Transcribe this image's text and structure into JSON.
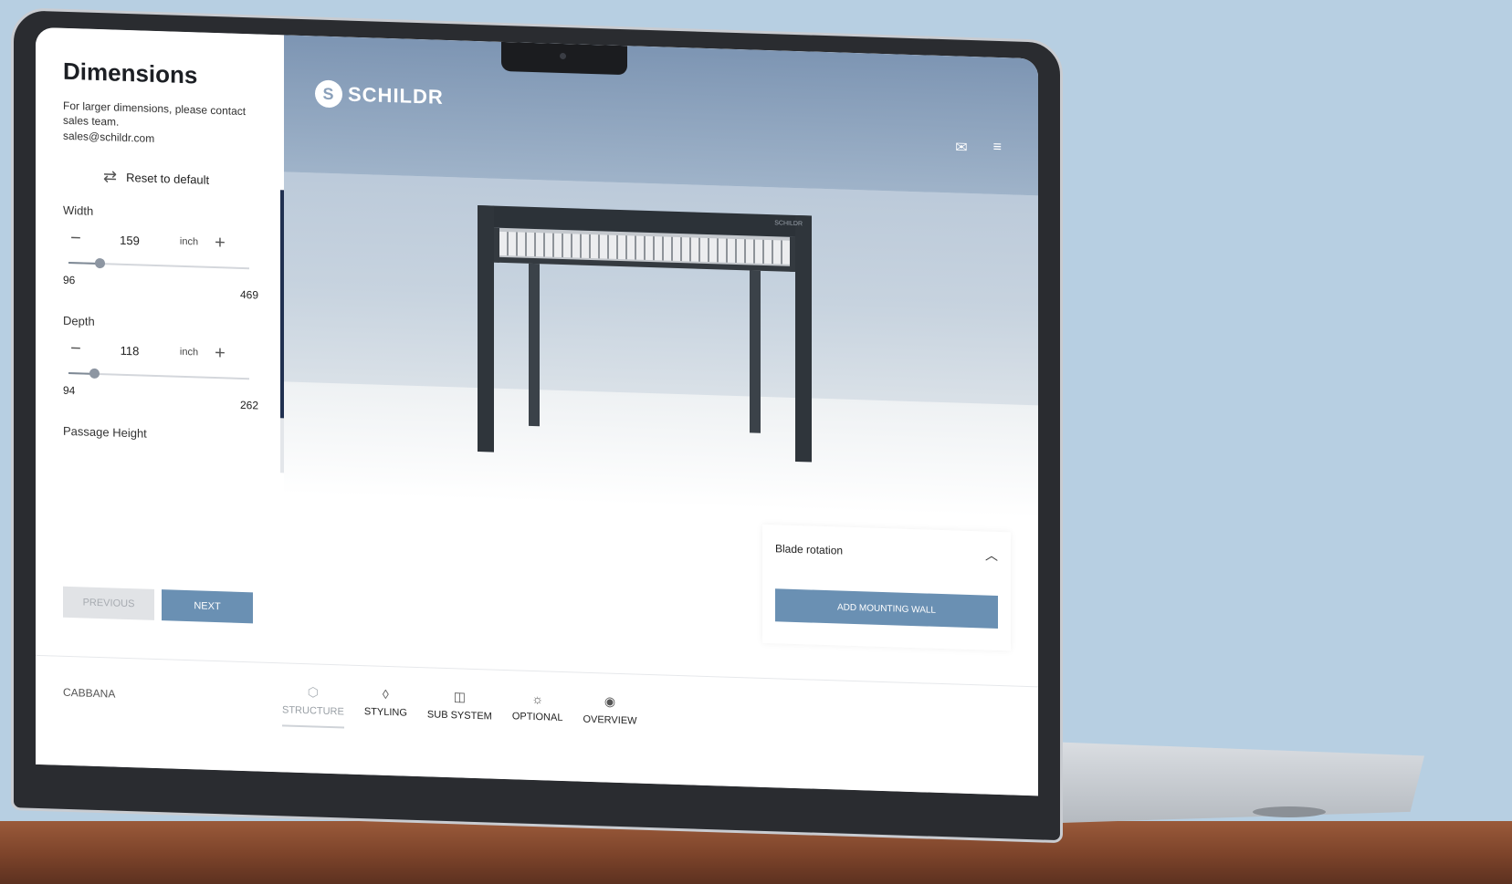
{
  "app": {
    "brand": "SCHILDR"
  },
  "sidebar": {
    "title": "Dimensions",
    "note": "For larger dimensions, please contact sales team.",
    "email": "sales@schildr.com",
    "reset_label": "Reset to default",
    "width": {
      "label": "Width",
      "value": "159",
      "unit": "inch",
      "min": "96",
      "max": "469",
      "fraction": 0.17
    },
    "depth": {
      "label": "Depth",
      "value": "118",
      "unit": "inch",
      "min": "94",
      "max": "262",
      "fraction": 0.14
    },
    "passage_height": {
      "label": "Passage Height"
    },
    "prev_label": "PREVIOUS",
    "next_label": "NEXT"
  },
  "viewport": {
    "pergola_brand": "SCHILDR"
  },
  "blade_panel": {
    "title": "Blade rotation",
    "button_label": "ADD MOUNTING WALL"
  },
  "bottombar": {
    "model": "CABBANA",
    "tabs": [
      {
        "label": "STRUCTURE",
        "icon": "cube-icon"
      },
      {
        "label": "STYLING",
        "icon": "drop-icon"
      },
      {
        "label": "SUB SYSTEM",
        "icon": "panel-icon"
      },
      {
        "label": "OPTIONAL",
        "icon": "sun-icon"
      },
      {
        "label": "OVERVIEW",
        "icon": "eye-icon"
      }
    ]
  },
  "colors": {
    "accent": "#6a90b3",
    "frame": "#2c3238",
    "background": "#b7cfe2"
  }
}
